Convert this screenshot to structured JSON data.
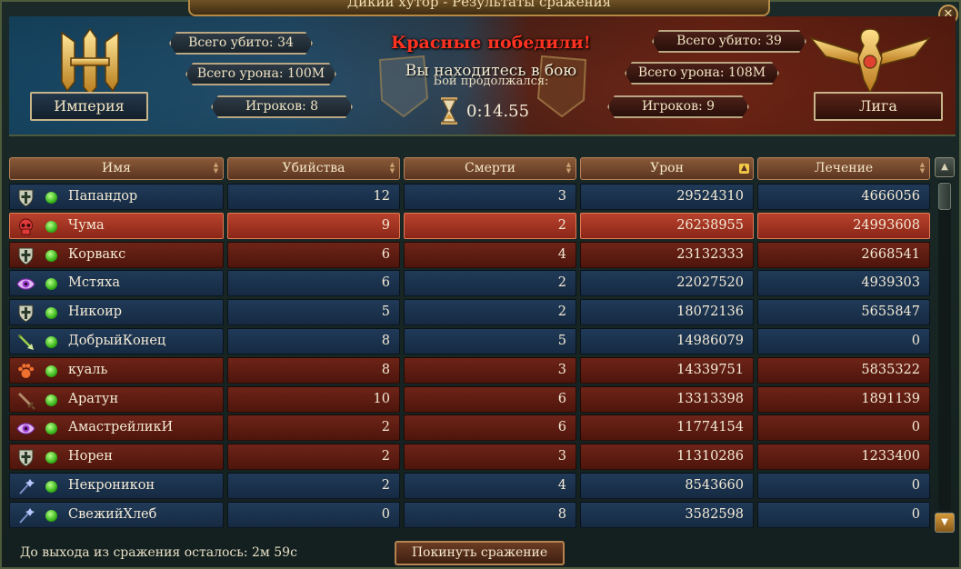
{
  "window": {
    "title": "Дикий хутор - Результаты сражения",
    "close_icon": "close-icon"
  },
  "banner": {
    "left": {
      "faction": "Империя",
      "kills": "Всего убито: 34",
      "damage": "Всего урона: 100M",
      "players": "Игроков: 8",
      "emblem_icon": "empire-emblem-icon",
      "accent": "#1e5f86"
    },
    "right": {
      "faction": "Лига",
      "kills": "Всего убито: 39",
      "damage": "Всего урона: 108M",
      "players": "Игроков: 9",
      "emblem_icon": "league-eagle-emblem-icon",
      "accent": "#8a2e1a"
    },
    "result": "Красные победили!",
    "status": "Вы находитесь в бою",
    "duration_label": "Бой продолжался:",
    "duration": "0:14.55",
    "timer_icon": "hourglass-icon"
  },
  "table": {
    "columns": [
      "Имя",
      "Убийства",
      "Смерти",
      "Урон",
      "Лечение"
    ],
    "sorted_column": "Урон",
    "rows": [
      {
        "team": "blue",
        "icon": "shield-icon",
        "name": "Папандор",
        "kills": "12",
        "deaths": "3",
        "damage": "29524310",
        "healing": "4666056"
      },
      {
        "team": "self",
        "icon": "skull-icon",
        "name": "Чума",
        "kills": "9",
        "deaths": "2",
        "damage": "26238955",
        "healing": "24993608"
      },
      {
        "team": "red",
        "icon": "shield-icon",
        "name": "Корвакс",
        "kills": "6",
        "deaths": "4",
        "damage": "23132333",
        "healing": "2668541"
      },
      {
        "team": "blue",
        "icon": "eye-icon",
        "name": "Мстяха",
        "kills": "6",
        "deaths": "2",
        "damage": "22027520",
        "healing": "4939303"
      },
      {
        "team": "blue",
        "icon": "shield-icon",
        "name": "Никоир",
        "kills": "5",
        "deaths": "2",
        "damage": "18072136",
        "healing": "5655847"
      },
      {
        "team": "blue",
        "icon": "arrow-icon",
        "name": "ДобрыйКонец",
        "kills": "8",
        "deaths": "5",
        "damage": "14986079",
        "healing": "0"
      },
      {
        "team": "red",
        "icon": "paw-icon",
        "name": "куаль",
        "kills": "8",
        "deaths": "3",
        "damage": "14339751",
        "healing": "5835322"
      },
      {
        "team": "red",
        "icon": "sword-icon",
        "name": "Аратун",
        "kills": "10",
        "deaths": "6",
        "damage": "13313398",
        "healing": "1891139"
      },
      {
        "team": "red",
        "icon": "eye-icon",
        "name": "АмастрейликИ",
        "kills": "2",
        "deaths": "6",
        "damage": "11774154",
        "healing": "0"
      },
      {
        "team": "red",
        "icon": "shield-icon",
        "name": "Норен",
        "kills": "2",
        "deaths": "3",
        "damage": "11310286",
        "healing": "1233400"
      },
      {
        "team": "blue",
        "icon": "staff-icon",
        "name": "Некроникон",
        "kills": "2",
        "deaths": "4",
        "damage": "8543660",
        "healing": "0"
      },
      {
        "team": "blue",
        "icon": "staff-icon",
        "name": "СвежийХлеб",
        "kills": "0",
        "deaths": "8",
        "damage": "3582598",
        "healing": "0"
      }
    ]
  },
  "footer": {
    "exit_timer": "До выхода из сражения осталось:  2м 59с",
    "leave_button": "Покинуть сражение"
  },
  "colors": {
    "blue_row": "#1b3350",
    "red_row": "#5e1c12",
    "self_row": "#a3351f",
    "win_text": "#ff3322",
    "online_dot": "#39b51a"
  }
}
